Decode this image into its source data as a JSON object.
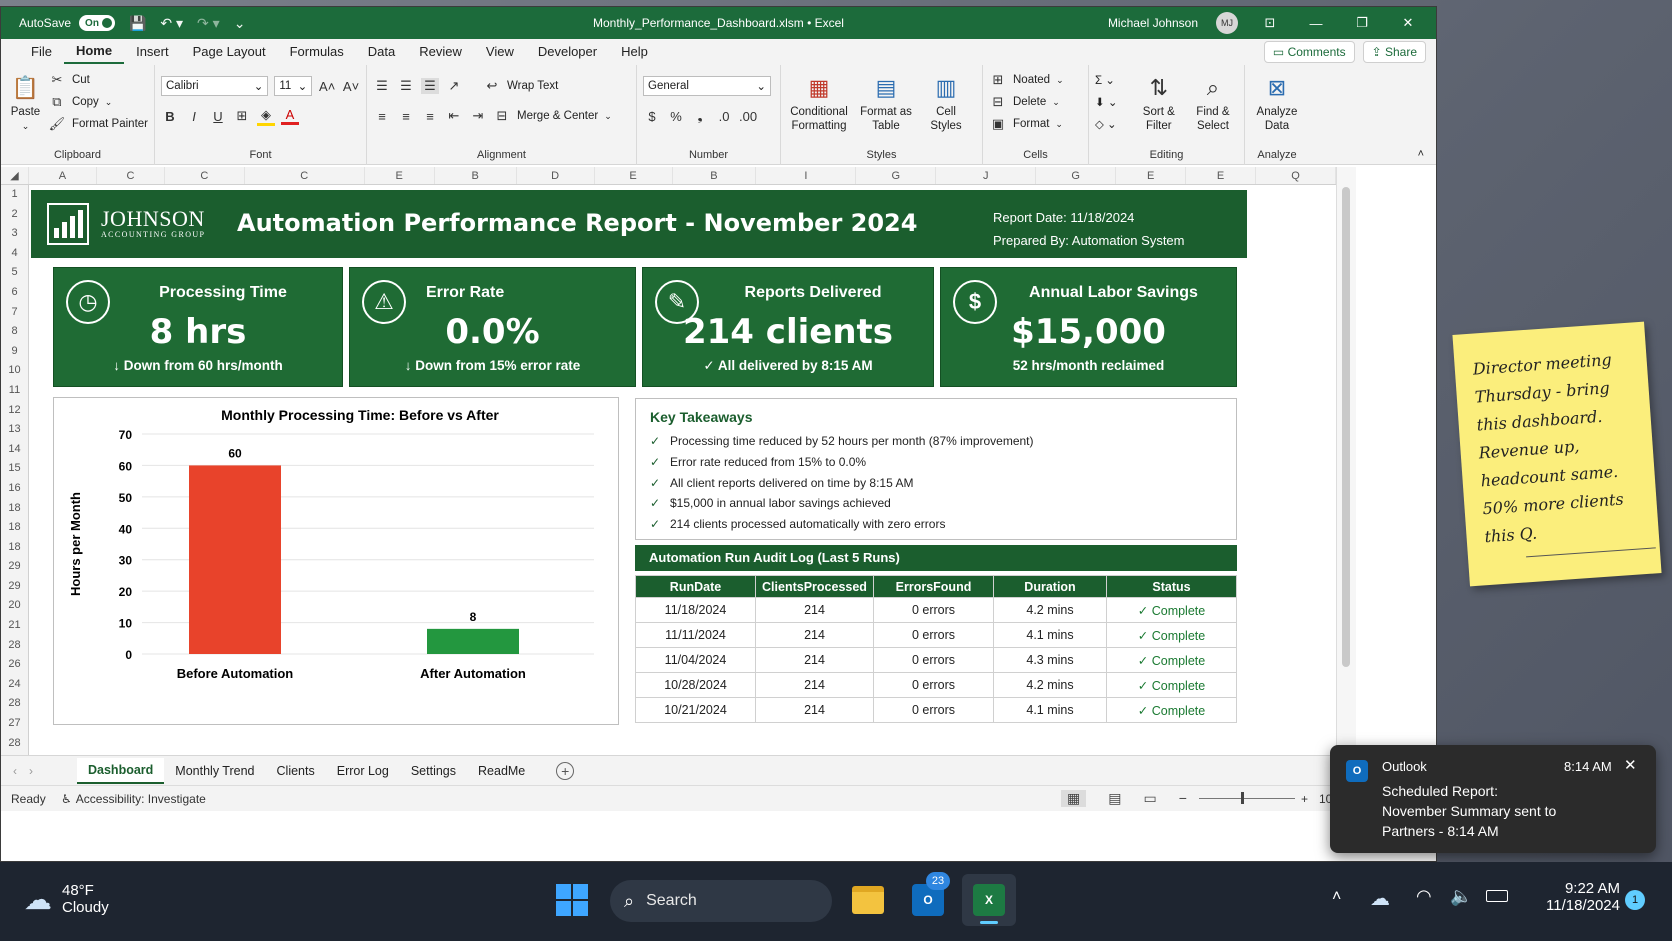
{
  "window": {
    "autosave_label": "AutoSave",
    "autosave_state": "On",
    "title": "Monthly_Performance_Dashboard.xlsm  •  Excel",
    "user": "Michael Johnson",
    "user_initials": "MJ"
  },
  "menu": {
    "tabs": [
      "File",
      "Home",
      "Insert",
      "Page Layout",
      "Formulas",
      "Data",
      "Review",
      "View",
      "Developer",
      "Help"
    ],
    "active": "Home",
    "comments": "Comments",
    "share": "Share"
  },
  "ribbon": {
    "clipboard": {
      "paste": "Paste",
      "cut": "Cut",
      "copy": "Copy",
      "format_painter": "Format Painter",
      "label": "Clipboard"
    },
    "font": {
      "name": "Calibri",
      "size": "11",
      "label": "Font"
    },
    "alignment": {
      "wrap": "Wrap Text",
      "merge": "Merge & Center",
      "label": "Alignment"
    },
    "number": {
      "format": "General",
      "label": "Number"
    },
    "styles": {
      "conditional_1": "Conditional",
      "conditional_2": "Formatting",
      "format_table_1": "Format as",
      "format_table_2": "Table",
      "cell_styles_1": "Cell",
      "cell_styles_2": "Styles",
      "label": "Styles"
    },
    "cells": {
      "insert": "Noated",
      "delete": "Delete",
      "format": "Format",
      "label": "Cells"
    },
    "editing": {
      "sort_1": "Sort &",
      "sort_2": "Filter",
      "find_1": "Find &",
      "find_2": "Select",
      "label": "Editing"
    },
    "analyze": {
      "btn_1": "Analyze",
      "btn_2": "Data",
      "label": "Analyze"
    }
  },
  "columns": [
    "A",
    "C",
    "C",
    "C",
    "E",
    "B",
    "D",
    "E",
    "B",
    "I",
    "G",
    "J",
    "G",
    "E",
    "E",
    "Q"
  ],
  "rows": [
    "1",
    "2",
    "3",
    "4",
    "5",
    "6",
    "7",
    "8",
    "9",
    "10",
    "11",
    "12",
    "13",
    "14",
    "15",
    "16",
    "18",
    "18",
    "18",
    "29",
    "29",
    "20",
    "21",
    "28",
    "26",
    "24",
    "28",
    "27",
    "28"
  ],
  "banner": {
    "logo_line1": "JOHNSON",
    "logo_line2": "ACCOUNTING GROUP",
    "title": "Automation Performance Report - November 2024",
    "report_date": "Report Date: 11/18/2024",
    "prepared_by": "Prepared By: Automation System"
  },
  "kpis": [
    {
      "icon": "clock-icon",
      "glyph": "◷",
      "title": "Processing Time",
      "value": "8 hrs",
      "sub": "↓ Down from 60 hrs/month"
    },
    {
      "icon": "warning-icon",
      "glyph": "⚠",
      "title": "Error Rate",
      "value": "0.0%",
      "sub": "↓ Down from 15% error rate"
    },
    {
      "icon": "document-check-icon",
      "glyph": "✎",
      "title": "Reports Delivered",
      "value": "214 clients",
      "sub": "✓ All delivered by 8:15 AM"
    },
    {
      "icon": "dollar-icon",
      "glyph": "$",
      "title": "Annual Labor Savings",
      "value": "$15,000",
      "sub": "52 hrs/month reclaimed"
    }
  ],
  "chart_data": {
    "type": "bar",
    "title": "Monthly Processing Time: Before vs After",
    "ylabel": "Hours per Month",
    "xlabel": "",
    "categories": [
      "Before Automation",
      "After Automation"
    ],
    "values": [
      60,
      8
    ],
    "colors": [
      "#e8432b",
      "#23973f"
    ],
    "ylim": [
      0,
      70
    ],
    "yticks": [
      0,
      10,
      20,
      30,
      40,
      50,
      60,
      70
    ],
    "grid": true,
    "data_labels": true
  },
  "takeaways": {
    "title": "Key Takeaways",
    "items": [
      "Processing time reduced by 52 hours per month (87% improvement)",
      "Error rate reduced from 15% to 0.0%",
      "All client reports delivered on time by 8:15 AM",
      "$15,000 in annual labor savings achieved",
      "214 clients processed automatically with zero errors"
    ]
  },
  "audit": {
    "title": "Automation Run Audit Log (Last 5 Runs)",
    "headers": [
      "RunDate",
      "ClientsProcessed",
      "ErrorsFound",
      "Duration",
      "Status"
    ],
    "rows": [
      [
        "11/18/2024",
        "214",
        "0 errors",
        "4.2 mins",
        "✓ Complete"
      ],
      [
        "11/11/2024",
        "214",
        "0 errors",
        "4.1 mins",
        "✓ Complete"
      ],
      [
        "11/04/2024",
        "214",
        "0 errors",
        "4.3 mins",
        "✓ Complete"
      ],
      [
        "10/28/2024",
        "214",
        "0 errors",
        "4.2 mins",
        "✓ Complete"
      ],
      [
        "10/21/2024",
        "214",
        "0 errors",
        "4.1 mins",
        "✓ Complete"
      ]
    ]
  },
  "sheet_tabs": [
    "Dashboard",
    "Monthly Trend",
    "Clients",
    "Error Log",
    "Settings",
    "ReadMe"
  ],
  "active_sheet": "Dashboard",
  "status": {
    "ready": "Ready",
    "accessibility": "Accessibility: Investigate",
    "zoom": "10"
  },
  "sticky_note": [
    "Director meeting",
    "Thursday - bring",
    "this dashboard.",
    "Revenue up,",
    "headcount same.",
    "50% more clients",
    "this Q."
  ],
  "toast": {
    "app": "Outlook",
    "time": "8:14 AM",
    "body_1": "Scheduled Report:",
    "body_2": "November Summary sent to",
    "body_3": "Partners - 8:14 AM"
  },
  "taskbar": {
    "temp": "48°F",
    "weather": "Cloudy",
    "search": "Search",
    "outlook_badge": "23",
    "time": "9:22 AM",
    "date": "11/18/2024",
    "notif": "1"
  }
}
